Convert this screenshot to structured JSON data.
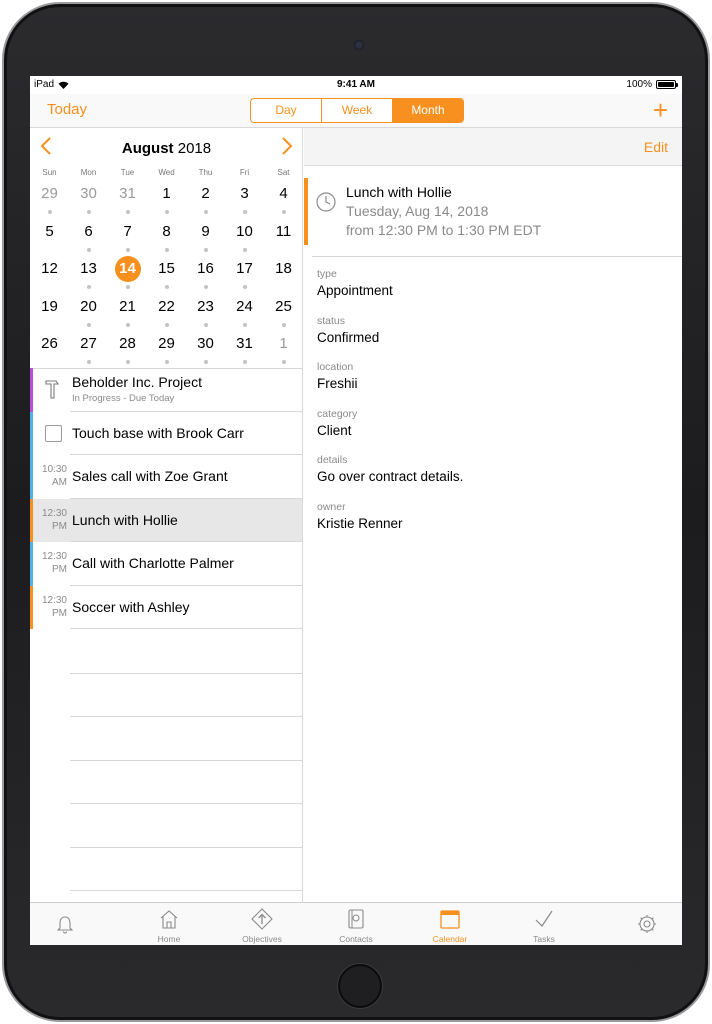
{
  "status_bar": {
    "carrier": "iPad",
    "time": "9:41 AM",
    "battery": "100%"
  },
  "nav": {
    "today_label": "Today",
    "segments": [
      "Day",
      "Week",
      "Month"
    ],
    "selected_segment": "Month",
    "add_label": "+"
  },
  "calendar": {
    "month": "August",
    "year": "2018",
    "weekdays": [
      "Sun",
      "Mon",
      "Tue",
      "Wed",
      "Thu",
      "Fri",
      "Sat"
    ],
    "days": [
      {
        "n": "29",
        "muted": true,
        "dot": true
      },
      {
        "n": "30",
        "muted": true,
        "dot": true
      },
      {
        "n": "31",
        "muted": true,
        "dot": true
      },
      {
        "n": "1",
        "dot": true
      },
      {
        "n": "2",
        "dot": true
      },
      {
        "n": "3",
        "dot": true
      },
      {
        "n": "4",
        "dot": true
      },
      {
        "n": "5"
      },
      {
        "n": "6",
        "dot": true
      },
      {
        "n": "7",
        "dot": true
      },
      {
        "n": "8",
        "dot": true
      },
      {
        "n": "9",
        "dot": true
      },
      {
        "n": "10",
        "dot": true
      },
      {
        "n": "11"
      },
      {
        "n": "12"
      },
      {
        "n": "13",
        "dot": true
      },
      {
        "n": "14",
        "today": true,
        "dot": true
      },
      {
        "n": "15",
        "dot": true
      },
      {
        "n": "16",
        "dot": true
      },
      {
        "n": "17",
        "dot": true
      },
      {
        "n": "18"
      },
      {
        "n": "19"
      },
      {
        "n": "20",
        "dot": true
      },
      {
        "n": "21",
        "dot": true
      },
      {
        "n": "22",
        "dot": true
      },
      {
        "n": "23",
        "dot": true
      },
      {
        "n": "24",
        "dot": true
      },
      {
        "n": "25",
        "dot": true
      },
      {
        "n": "26"
      },
      {
        "n": "27",
        "dot": true
      },
      {
        "n": "28",
        "dot": true
      },
      {
        "n": "29",
        "dot": true
      },
      {
        "n": "30",
        "dot": true
      },
      {
        "n": "31",
        "dot": true
      },
      {
        "n": "1",
        "muted": true,
        "dot": true
      }
    ]
  },
  "agenda": [
    {
      "kind": "project",
      "title": "Beholder Inc. Project",
      "subtitle": "In Progress - Due Today",
      "color": "#b84fd8"
    },
    {
      "kind": "task",
      "title": "Touch base with Brook Carr",
      "color": "#4fb3e8"
    },
    {
      "kind": "event",
      "time_top": "10:30",
      "time_bottom": "AM",
      "title": "Sales call with Zoe Grant",
      "color": "#4fb3e8"
    },
    {
      "kind": "event",
      "time_top": "12:30",
      "time_bottom": "PM",
      "title": "Lunch with Hollie",
      "color": "#f7901e",
      "selected": true
    },
    {
      "kind": "event",
      "time_top": "12:30",
      "time_bottom": "PM",
      "title": "Call with Charlotte Palmer",
      "color": "#4fb3e8"
    },
    {
      "kind": "event",
      "time_top": "12:30",
      "time_bottom": "PM",
      "title": "Soccer with Ashley",
      "color": "#f7901e"
    }
  ],
  "detail": {
    "edit_label": "Edit",
    "title": "Lunch with Hollie",
    "date": "Tuesday, Aug 14, 2018",
    "time": "from 12:30 PM to 1:30 PM EDT",
    "fields": [
      {
        "label": "type",
        "value": "Appointment"
      },
      {
        "label": "status",
        "value": "Confirmed"
      },
      {
        "label": "location",
        "value": "Freshii"
      },
      {
        "label": "category",
        "value": "Client"
      },
      {
        "label": "details",
        "value": "Go over contract details."
      },
      {
        "label": "owner",
        "value": "Kristie Renner"
      }
    ]
  },
  "tabs": [
    {
      "icon": "bell-icon",
      "label": ""
    },
    {
      "icon": "home-icon",
      "label": "Home"
    },
    {
      "icon": "objectives-icon",
      "label": "Objectives"
    },
    {
      "icon": "contacts-icon",
      "label": "Contacts"
    },
    {
      "icon": "calendar-icon",
      "label": "Calendar",
      "active": true
    },
    {
      "icon": "checkmark-icon",
      "label": "Tasks"
    },
    {
      "icon": "gear-icon",
      "label": ""
    }
  ],
  "colors": {
    "accent": "#f7901e",
    "project": "#b84fd8",
    "blue": "#4fb3e8"
  }
}
